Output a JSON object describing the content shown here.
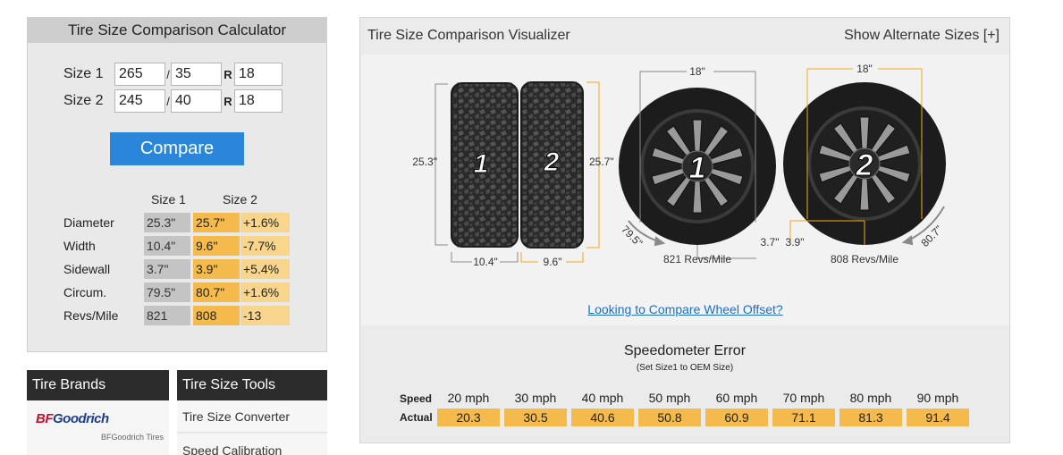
{
  "calculator": {
    "title": "Tire Size Comparison Calculator",
    "size1": {
      "label": "Size 1",
      "width": "265",
      "aspect": "35",
      "diameter": "18"
    },
    "size2": {
      "label": "Size 2",
      "width": "245",
      "aspect": "40",
      "diameter": "18"
    },
    "slash": "/",
    "r_label": "R",
    "compare_button": "Compare",
    "col_size1": "Size 1",
    "col_size2": "Size 2",
    "rows": [
      {
        "label": "Diameter",
        "size1": "25.3\"",
        "size2": "25.7\"",
        "diff": "+1.6%"
      },
      {
        "label": "Width",
        "size1": "10.4\"",
        "size2": "9.6\"",
        "diff": "-7.7%"
      },
      {
        "label": "Sidewall",
        "size1": "3.7\"",
        "size2": "3.9\"",
        "diff": "+5.4%"
      },
      {
        "label": "Circum.",
        "size1": "79.5\"",
        "size2": "80.7\"",
        "diff": "+1.6%"
      },
      {
        "label": "Revs/Mile",
        "size1": "821",
        "size2": "808",
        "diff": "-13"
      }
    ]
  },
  "brands": {
    "title": "Tire Brands",
    "logo_text_a": "BF",
    "logo_text_b": "Goodrich",
    "caption": "BFGoodrich Tires"
  },
  "tools": {
    "title": "Tire Size Tools",
    "items": [
      "Tire Size Converter",
      "Speed Calibration"
    ]
  },
  "visualizer": {
    "title": "Tire Size Comparison Visualizer",
    "alt_link": "Show Alternate Sizes [+]",
    "tread": {
      "tire1_number": "1",
      "tire2_number": "2",
      "diameter1": "25.3\"",
      "diameter2": "25.7\"",
      "width1": "10.4\"",
      "width2": "9.6\""
    },
    "wheels": {
      "wheel1_number": "1",
      "wheel2_number": "2",
      "rim1": "18\"",
      "rim2": "18\"",
      "sidewall1": "3.7\"",
      "sidewall2": "3.9\"",
      "circ1": "79.5\"",
      "circ2": "80.7\"",
      "revs1": "821 Revs/Mile",
      "revs2": "808 Revs/Mile"
    },
    "offset_link": "Looking to Compare Wheel Offset?"
  },
  "speedometer": {
    "title": "Speedometer Error",
    "subtitle": "(Set Size1 to OEM Size)",
    "speed_label": "Speed",
    "actual_label": "Actual",
    "speeds": [
      "20 mph",
      "30 mph",
      "40 mph",
      "50 mph",
      "60 mph",
      "70 mph",
      "80 mph",
      "90 mph"
    ],
    "actuals": [
      "20.3",
      "30.5",
      "40.6",
      "50.8",
      "60.9",
      "71.1",
      "81.3",
      "91.4"
    ]
  },
  "colors": {
    "accent_blue": "#2a86d8",
    "size2_orange": "#f4bb4c",
    "diff_light_orange": "#f7d58c",
    "size1_gray": "#c4c4c4",
    "link_blue": "#1d6fc1"
  }
}
